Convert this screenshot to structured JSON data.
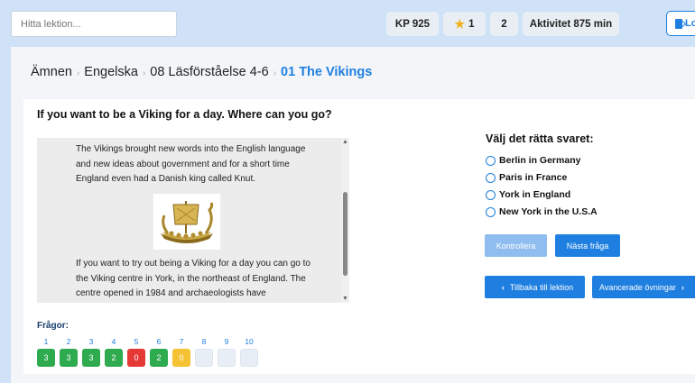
{
  "search": {
    "placeholder": "Hitta lektion..."
  },
  "header": {
    "kp": "KP 925",
    "stars": "1",
    "level": "2",
    "activity": "Aktivitet 875 min",
    "logout_label": "Lo"
  },
  "breadcrumb": {
    "items": [
      "Ämnen",
      "Engelska",
      "08 Läsförståelse 4-6",
      "01 The Vikings"
    ]
  },
  "question": "If you want to be a Viking for a day. Where can you go?",
  "reading": {
    "paragraph1": "The Vikings brought new words into the English language and new ideas about government and for a short time England even had a Danish king called Knut.",
    "paragraph2": "If you want to try out being a Viking for a day you can go to the Viking centre in York, in the northeast of England. The centre opened in 1984 and archaeologists have"
  },
  "answers": {
    "title": "Välj det rätta svaret:",
    "options": [
      "Berlin in Germany",
      "Paris in France",
      "York in England",
      "New York in the U.S.A"
    ]
  },
  "buttons": {
    "check": "Kontrollera",
    "next": "Nästa fråga",
    "back": "Tillbaka till lektion",
    "advanced": "Avancerade övningar"
  },
  "questions_nav": {
    "label": "Frågor:",
    "numbers": [
      "1",
      "2",
      "3",
      "4",
      "5",
      "6",
      "7",
      "8",
      "9",
      "10"
    ],
    "scores": [
      "3",
      "3",
      "3",
      "2",
      "0",
      "2",
      "0",
      "",
      "",
      ""
    ]
  },
  "colors": {
    "accent": "#1f7fe0",
    "correct": "#2eaa4f",
    "wrong": "#e53935",
    "pending": "#f5c233",
    "empty": "#e8eef6"
  }
}
